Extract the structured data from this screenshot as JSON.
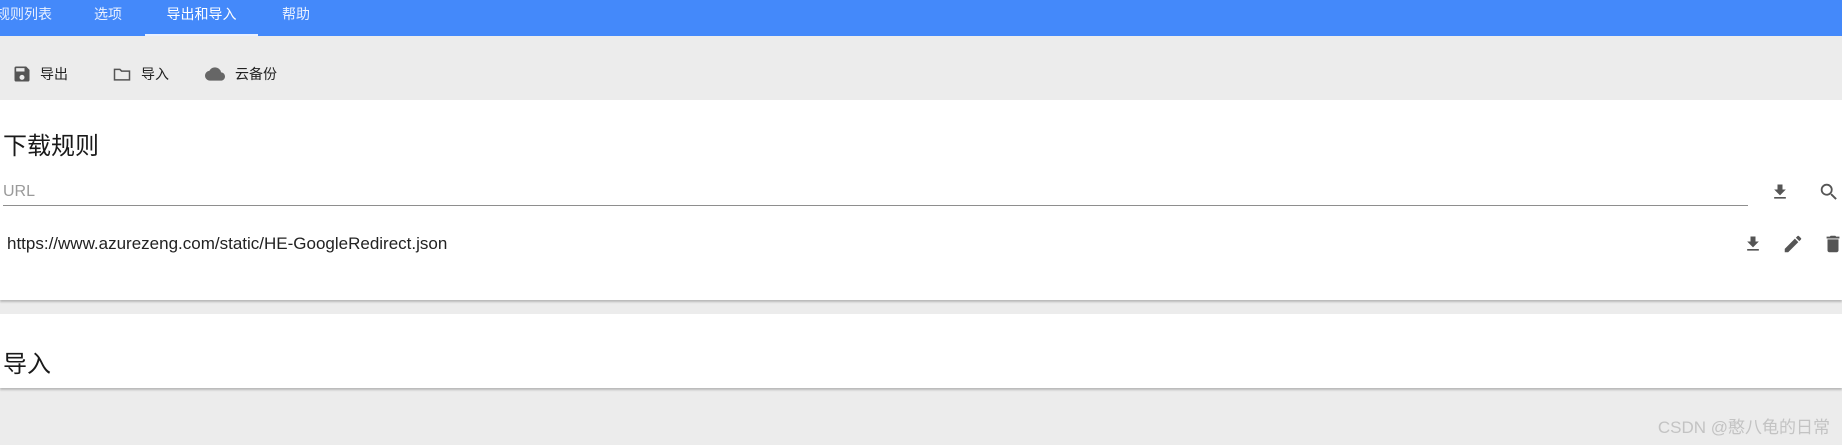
{
  "tabs": [
    {
      "label": "规则列表",
      "active": false
    },
    {
      "label": "选项",
      "active": false
    },
    {
      "label": "导出和导入",
      "active": true
    },
    {
      "label": "帮助",
      "active": false
    }
  ],
  "toolbar": {
    "export_label": "导出",
    "import_label": "导入",
    "cloud_label": "云备份"
  },
  "download_rules": {
    "title": "下载规则",
    "url_placeholder": "URL",
    "rules": [
      {
        "url": "https://www.azurezeng.com/static/HE-GoogleRedirect.json"
      }
    ]
  },
  "import_section": {
    "title": "导入"
  },
  "watermark": "CSDN @憨八龟的日常",
  "colors": {
    "header": "#4489fa",
    "background": "#ececec",
    "card": "#ffffff",
    "icon": "#555555"
  },
  "icons": {
    "export": "save-icon",
    "import": "folder-icon",
    "cloud": "cloud-icon",
    "download": "download-icon",
    "search": "search-icon",
    "edit": "pencil-icon",
    "delete": "trash-icon"
  }
}
